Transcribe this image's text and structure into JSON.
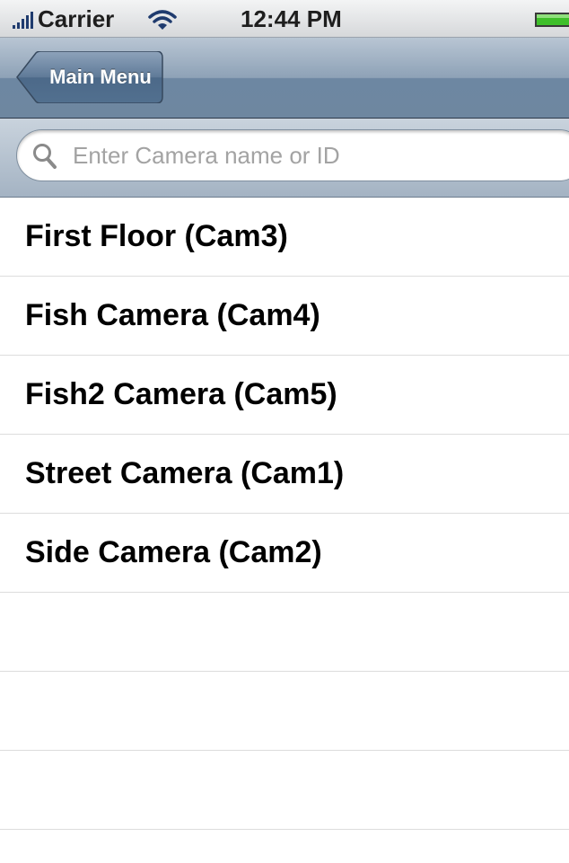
{
  "status_bar": {
    "carrier": "Carrier",
    "time": "12:44 PM",
    "icons": [
      "signal-icon",
      "wifi-icon",
      "battery-icon"
    ],
    "battery_color": "#3fbf2a"
  },
  "nav_bar": {
    "back_label": "Main Menu",
    "tint": "#6d87a2"
  },
  "search": {
    "placeholder": "Enter Camera name or ID",
    "value": ""
  },
  "cameras": [
    {
      "label": "First Floor (Cam3)"
    },
    {
      "label": "Fish Camera (Cam4)"
    },
    {
      "label": "Fish2 Camera (Cam5)"
    },
    {
      "label": "Street Camera (Cam1)"
    },
    {
      "label": "Side Camera (Cam2)"
    }
  ]
}
